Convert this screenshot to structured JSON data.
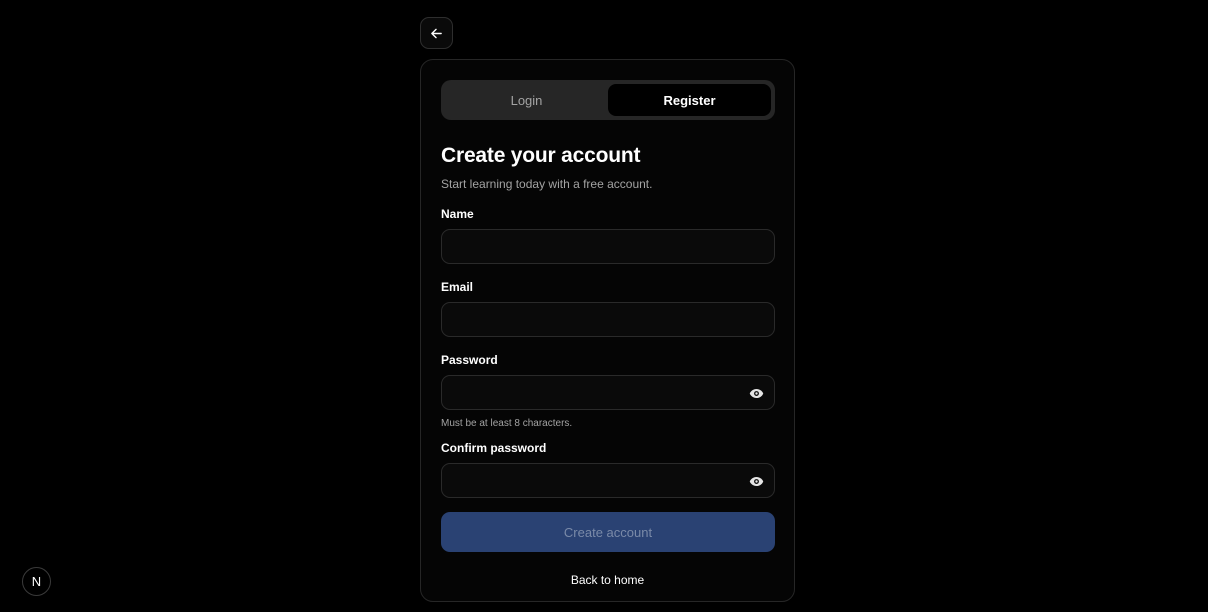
{
  "tabs": [
    {
      "label": "Login",
      "active": false
    },
    {
      "label": "Register",
      "active": true
    }
  ],
  "form": {
    "title": "Create your account",
    "subtitle": "Start learning today with a free account.",
    "fields": {
      "name": {
        "label": "Name",
        "value": "",
        "placeholder": ""
      },
      "email": {
        "label": "Email",
        "value": "",
        "placeholder": ""
      },
      "password": {
        "label": "Password",
        "value": "",
        "placeholder": "",
        "hint": "Must be at least 8 characters."
      },
      "confirm": {
        "label": "Confirm password",
        "value": "",
        "placeholder": ""
      }
    },
    "submit_label": "Create account",
    "back_home_label": "Back to home"
  },
  "badge": {
    "label": "N"
  },
  "icons": {
    "back": "arrow-left-icon",
    "password_eye": "eye-icon",
    "confirm_eye": "eye-icon"
  },
  "colors": {
    "background": "#000000",
    "submit_bg": "#2a4273",
    "submit_text": "#7a8aa8"
  }
}
